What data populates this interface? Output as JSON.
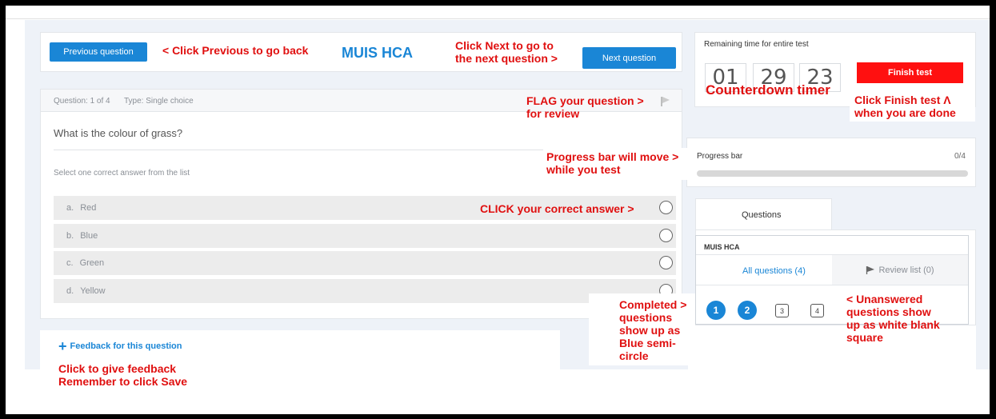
{
  "nav": {
    "previous_label": "Previous question",
    "next_label": "Next question",
    "exam_title": "MUIS HCA"
  },
  "question": {
    "number_text": "Question: 1 of 4",
    "type_text": "Type: Single choice",
    "text": "What is the colour of grass?",
    "instruction": "Select one correct answer from the list",
    "options": [
      {
        "letter": "a.",
        "label": "Red"
      },
      {
        "letter": "b.",
        "label": "Blue"
      },
      {
        "letter": "c.",
        "label": "Green"
      },
      {
        "letter": "d.",
        "label": "Yellow"
      }
    ],
    "feedback_label": "Feedback for this question"
  },
  "timer": {
    "title": "Remaining time for entire test",
    "hours": "01",
    "minutes": "29",
    "seconds": "23",
    "finish_label": "Finish test"
  },
  "progress": {
    "label": "Progress bar",
    "count": "0/4",
    "fraction": 0
  },
  "questions_panel": {
    "tab_label": "Questions",
    "section_title": "MUIS HCA",
    "all_label": "All questions (4)",
    "review_label": "Review list (0)",
    "numbers": [
      "1",
      "2",
      "3",
      "4"
    ]
  },
  "annotations": {
    "prev": "< Click Previous to go back",
    "next_line1": "Click Next to go to",
    "next_line2": "the next question >",
    "flag_line1": "FLAG your question >",
    "flag_line2": "for review",
    "progress_line1": "Progress bar will move >",
    "progress_line2": "while you test",
    "answer": "CLICK your correct answer >",
    "countdown": "Counterdown timer",
    "finish_line1": "Click Finish test  Λ",
    "finish_line2": "when you are done",
    "completed_1": "Completed >",
    "completed_2": "questions",
    "completed_3": "show up as",
    "completed_4": "Blue semi-",
    "completed_5": "circle",
    "unanswered_1": "< Unanswered",
    "unanswered_2": "questions show",
    "unanswered_3": "up as white blank",
    "unanswered_4": "square",
    "feedback_1": "Click to give feedback",
    "feedback_2": "Remember to click Save"
  },
  "colors": {
    "accent_blue": "#1a86d6",
    "finish_red": "#ff1010",
    "annotation_red": "#e01010"
  }
}
